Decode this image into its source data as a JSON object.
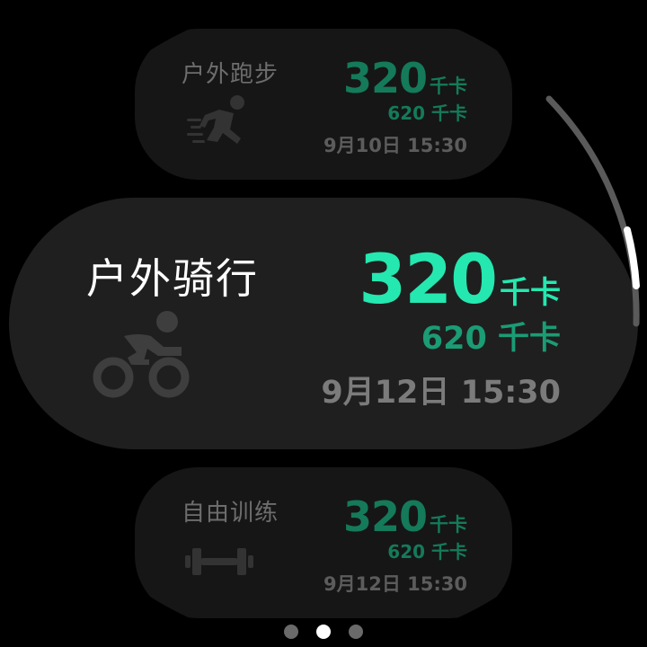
{
  "workouts": [
    {
      "title": "户外跑步",
      "kcal": "320",
      "kcal_unit": "千卡",
      "sub": "620 千卡",
      "date": "9月10日 15:30",
      "icon": "running-icon"
    },
    {
      "title": "户外骑行",
      "kcal": "320",
      "kcal_unit": "千卡",
      "sub": "620 千卡",
      "date": "9月12日 15:30",
      "icon": "cycling-icon"
    },
    {
      "title": "自由训练",
      "kcal": "320",
      "kcal_unit": "千卡",
      "sub": "620 千卡",
      "date": "9月12日 15:30",
      "icon": "dumbbell-icon"
    }
  ],
  "pagination": {
    "total": 3,
    "active_index": 1
  },
  "colors": {
    "accent": "#24e8b0",
    "accent_dim": "#147a5a",
    "card_bg": "#1f1f1f"
  }
}
